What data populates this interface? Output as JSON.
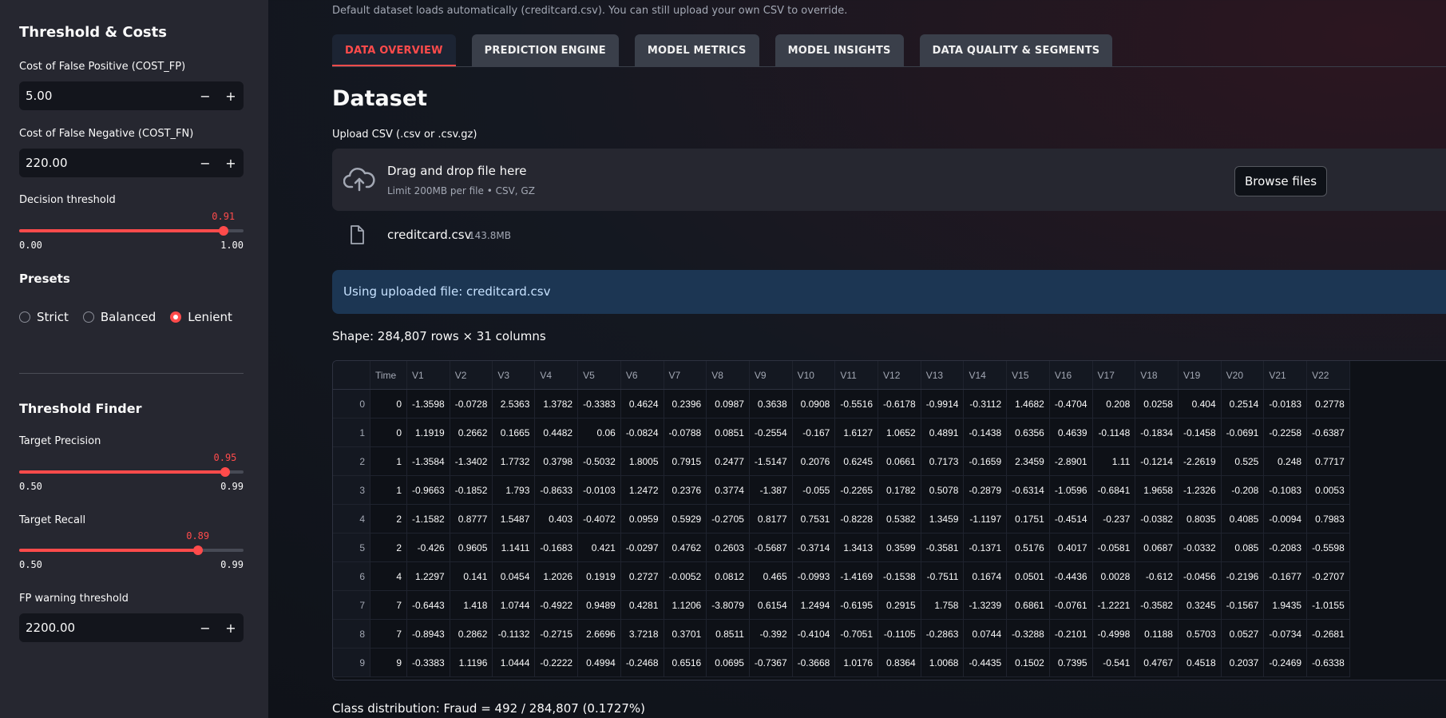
{
  "sidebar": {
    "section_title": "Threshold & Costs",
    "cost_fp": {
      "label": "Cost of False Positive (COST_FP)",
      "value": "5.00",
      "minus": "−",
      "plus": "+"
    },
    "cost_fn": {
      "label": "Cost of False Negative (COST_FN)",
      "value": "220.00",
      "minus": "−",
      "plus": "+"
    },
    "decision_threshold": {
      "label": "Decision threshold",
      "current": "0.91",
      "min": "0.00",
      "max": "1.00",
      "fraction": 0.91
    },
    "presets": {
      "title": "Presets",
      "options": [
        "Strict",
        "Balanced",
        "Lenient"
      ],
      "selected": "Lenient"
    },
    "finder_title": "Threshold Finder",
    "target_precision": {
      "label": "Target Precision",
      "current": "0.95",
      "min": "0.50",
      "max": "0.99",
      "fraction": 0.918
    },
    "target_recall": {
      "label": "Target Recall",
      "current": "0.89",
      "min": "0.50",
      "max": "0.99",
      "fraction": 0.796
    },
    "fp_warning": {
      "label": "FP warning threshold",
      "value": "2200.00",
      "minus": "−",
      "plus": "+"
    }
  },
  "main": {
    "caption": "Default dataset loads automatically (creditcard.csv). You can still upload your own CSV to override.",
    "tabs": [
      "DATA OVERVIEW",
      "PREDICTION ENGINE",
      "MODEL METRICS",
      "MODEL INSIGHTS",
      "DATA QUALITY & SEGMENTS"
    ],
    "active_tab": "DATA OVERVIEW",
    "heading": "Dataset",
    "upload_label": "Upload CSV (.csv or .csv.gz)",
    "dropzone": {
      "title": "Drag and drop file here",
      "subtitle": "Limit 200MB per file • CSV, GZ",
      "browse": "Browse files",
      "icon": "cloud-upload-icon"
    },
    "file": {
      "name": "creditcard.csv",
      "size": "143.8MB",
      "remove": "✕",
      "icon": "file-icon"
    },
    "info": "Using uploaded file: creditcard.csv",
    "shape": "Shape: 284,807 rows × 31 columns",
    "class_distribution": "Class distribution: Fraud = 492 / 284,807 (0.1727%)"
  },
  "table": {
    "columns": [
      "",
      "Time",
      "V1",
      "V2",
      "V3",
      "V4",
      "V5",
      "V6",
      "V7",
      "V8",
      "V9",
      "V10",
      "V11",
      "V12",
      "V13",
      "V14",
      "V15",
      "V16",
      "V17",
      "V18",
      "V19",
      "V20",
      "V21",
      "V22"
    ],
    "rows": [
      [
        "0",
        "0",
        "-1.3598",
        "-0.0728",
        "2.5363",
        "1.3782",
        "-0.3383",
        "0.4624",
        "0.2396",
        "0.0987",
        "0.3638",
        "0.0908",
        "-0.5516",
        "-0.6178",
        "-0.9914",
        "-0.3112",
        "1.4682",
        "-0.4704",
        "0.208",
        "0.0258",
        "0.404",
        "0.2514",
        "-0.0183",
        "0.2778"
      ],
      [
        "1",
        "0",
        "1.1919",
        "0.2662",
        "0.1665",
        "0.4482",
        "0.06",
        "-0.0824",
        "-0.0788",
        "0.0851",
        "-0.2554",
        "-0.167",
        "1.6127",
        "1.0652",
        "0.4891",
        "-0.1438",
        "0.6356",
        "0.4639",
        "-0.1148",
        "-0.1834",
        "-0.1458",
        "-0.0691",
        "-0.2258",
        "-0.6387"
      ],
      [
        "2",
        "1",
        "-1.3584",
        "-1.3402",
        "1.7732",
        "0.3798",
        "-0.5032",
        "1.8005",
        "0.7915",
        "0.2477",
        "-1.5147",
        "0.2076",
        "0.6245",
        "0.0661",
        "0.7173",
        "-0.1659",
        "2.3459",
        "-2.8901",
        "1.11",
        "-0.1214",
        "-2.2619",
        "0.525",
        "0.248",
        "0.7717"
      ],
      [
        "3",
        "1",
        "-0.9663",
        "-0.1852",
        "1.793",
        "-0.8633",
        "-0.0103",
        "1.2472",
        "0.2376",
        "0.3774",
        "-1.387",
        "-0.055",
        "-0.2265",
        "0.1782",
        "0.5078",
        "-0.2879",
        "-0.6314",
        "-1.0596",
        "-0.6841",
        "1.9658",
        "-1.2326",
        "-0.208",
        "-0.1083",
        "0.0053"
      ],
      [
        "4",
        "2",
        "-1.1582",
        "0.8777",
        "1.5487",
        "0.403",
        "-0.4072",
        "0.0959",
        "0.5929",
        "-0.2705",
        "0.8177",
        "0.7531",
        "-0.8228",
        "0.5382",
        "1.3459",
        "-1.1197",
        "0.1751",
        "-0.4514",
        "-0.237",
        "-0.0382",
        "0.8035",
        "0.4085",
        "-0.0094",
        "0.7983"
      ],
      [
        "5",
        "2",
        "-0.426",
        "0.9605",
        "1.1411",
        "-0.1683",
        "0.421",
        "-0.0297",
        "0.4762",
        "0.2603",
        "-0.5687",
        "-0.3714",
        "1.3413",
        "0.3599",
        "-0.3581",
        "-0.1371",
        "0.5176",
        "0.4017",
        "-0.0581",
        "0.0687",
        "-0.0332",
        "0.085",
        "-0.2083",
        "-0.5598"
      ],
      [
        "6",
        "4",
        "1.2297",
        "0.141",
        "0.0454",
        "1.2026",
        "0.1919",
        "0.2727",
        "-0.0052",
        "0.0812",
        "0.465",
        "-0.0993",
        "-1.4169",
        "-0.1538",
        "-0.7511",
        "0.1674",
        "0.0501",
        "-0.4436",
        "0.0028",
        "-0.612",
        "-0.0456",
        "-0.2196",
        "-0.1677",
        "-0.2707"
      ],
      [
        "7",
        "7",
        "-0.6443",
        "1.418",
        "1.0744",
        "-0.4922",
        "0.9489",
        "0.4281",
        "1.1206",
        "-3.8079",
        "0.6154",
        "1.2494",
        "-0.6195",
        "0.2915",
        "1.758",
        "-1.3239",
        "0.6861",
        "-0.0761",
        "-1.2221",
        "-0.3582",
        "0.3245",
        "-0.1567",
        "1.9435",
        "-1.0155"
      ],
      [
        "8",
        "7",
        "-0.8943",
        "0.2862",
        "-0.1132",
        "-0.2715",
        "2.6696",
        "3.7218",
        "0.3701",
        "0.8511",
        "-0.392",
        "-0.4104",
        "-0.7051",
        "-0.1105",
        "-0.2863",
        "0.0744",
        "-0.3288",
        "-0.2101",
        "-0.4998",
        "0.1188",
        "0.5703",
        "0.0527",
        "-0.0734",
        "-0.2681"
      ],
      [
        "9",
        "9",
        "-0.3383",
        "1.1196",
        "1.0444",
        "-0.2222",
        "0.4994",
        "-0.2468",
        "0.6516",
        "0.0695",
        "-0.7367",
        "-0.3668",
        "1.0176",
        "0.8364",
        "1.0068",
        "-0.4435",
        "0.1502",
        "0.7395",
        "-0.541",
        "0.4767",
        "0.4518",
        "0.2037",
        "-0.2469",
        "-0.6338"
      ]
    ]
  }
}
